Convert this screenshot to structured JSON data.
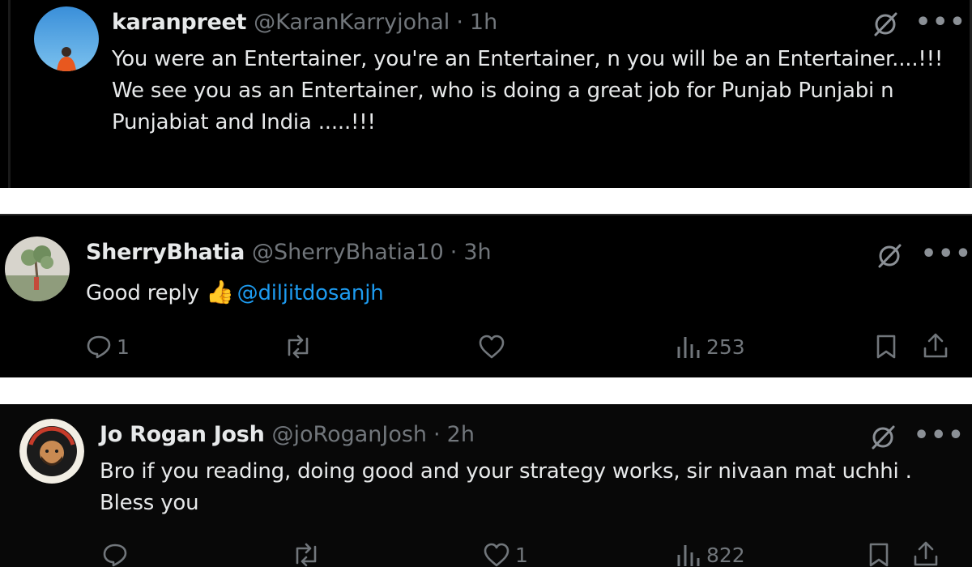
{
  "tweets": [
    {
      "author_name": "karanpreet",
      "handle": "@KaranKarryjohal",
      "separator": "·",
      "time": "1h",
      "paragraphs": [
        "You were an Entertainer, you're an Entertainer, n you will be an Entertainer....!!!",
        "We see you as an Entertainer, who is doing a great job for Punjab Punjabi n Punjabiat and India .....!!!"
      ]
    },
    {
      "author_name": "SherryBhatia",
      "handle": "@SherryBhatia10",
      "separator": "·",
      "time": "3h",
      "text": "Good reply",
      "emoji": "👍",
      "mention": "@diljitdosanjh",
      "replies": "1",
      "views": "253"
    },
    {
      "author_name": "Jo Rogan Josh",
      "handle": "@joRoganJosh",
      "separator": "·",
      "time": "2h",
      "text": "Bro if you reading, doing good and your strategy works, sir nivaan mat uchhi . Bless you",
      "likes": "1",
      "views": "822"
    }
  ],
  "icons": {
    "grok": "grok-icon",
    "more": "•••",
    "reply": "reply-icon",
    "repost": "repost-icon",
    "like": "heart-icon",
    "views": "analytics-icon",
    "bookmark": "bookmark-icon",
    "share": "share-icon"
  },
  "colors": {
    "background": "#000000",
    "text": "#e7e9ea",
    "muted": "#71767b",
    "link": "#1d9bf0"
  }
}
